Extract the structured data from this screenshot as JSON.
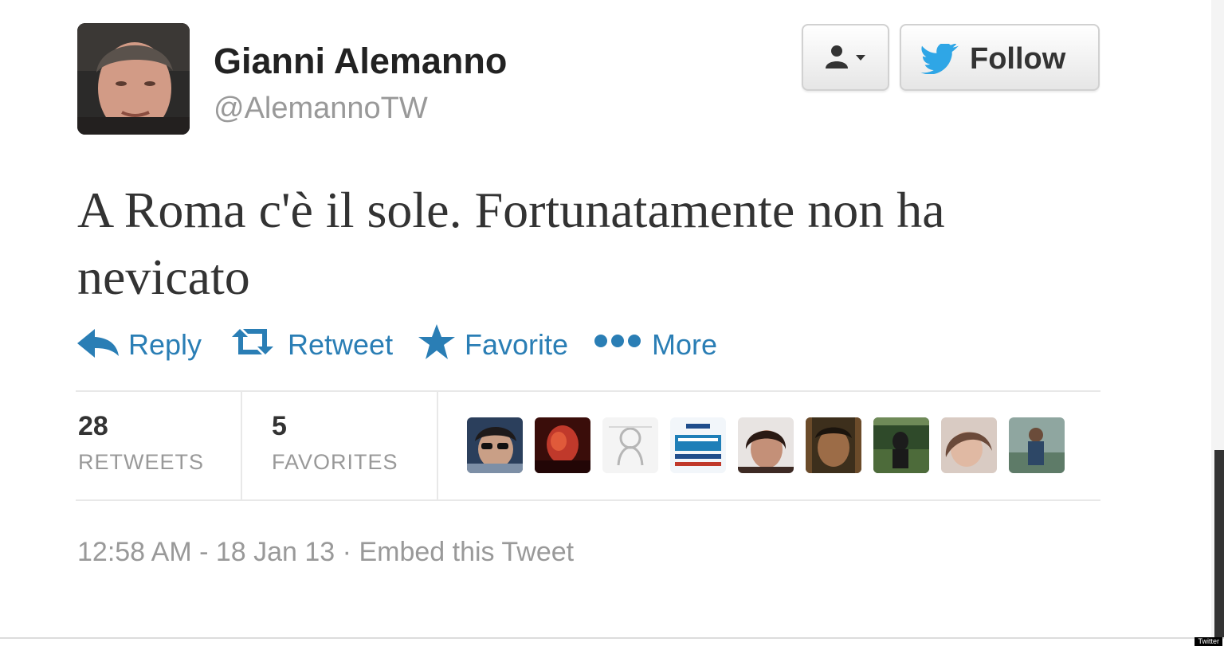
{
  "author": {
    "name": "Gianni Alemanno",
    "handle": "@AlemannoTW"
  },
  "header_buttons": {
    "user_actions_icon": "person-dropdown-icon",
    "follow_icon": "twitter-bird-icon",
    "follow_label": "Follow"
  },
  "tweet": {
    "text": "A Roma c'è il sole. Fortunatamente non ha nevicato"
  },
  "actions": [
    {
      "icon": "reply-arrow-icon",
      "label": "Reply"
    },
    {
      "icon": "retweet-icon",
      "label": "Retweet"
    },
    {
      "icon": "star-icon",
      "label": "Favorite"
    },
    {
      "icon": "ellipsis-icon",
      "label": "More"
    }
  ],
  "stats": {
    "retweets_count": "28",
    "retweets_label": "RETWEETS",
    "favorites_count": "5",
    "favorites_label": "FAVORITES"
  },
  "meta": {
    "timestamp": "12:58 AM - 18 Jan 13",
    "separator": "·",
    "embed_label": "Embed this Tweet"
  },
  "watermark": "Twitter",
  "colors": {
    "link": "#2a7eb5",
    "text": "#333333",
    "muted": "#999999",
    "follow_bird": "#2fa6e6"
  }
}
